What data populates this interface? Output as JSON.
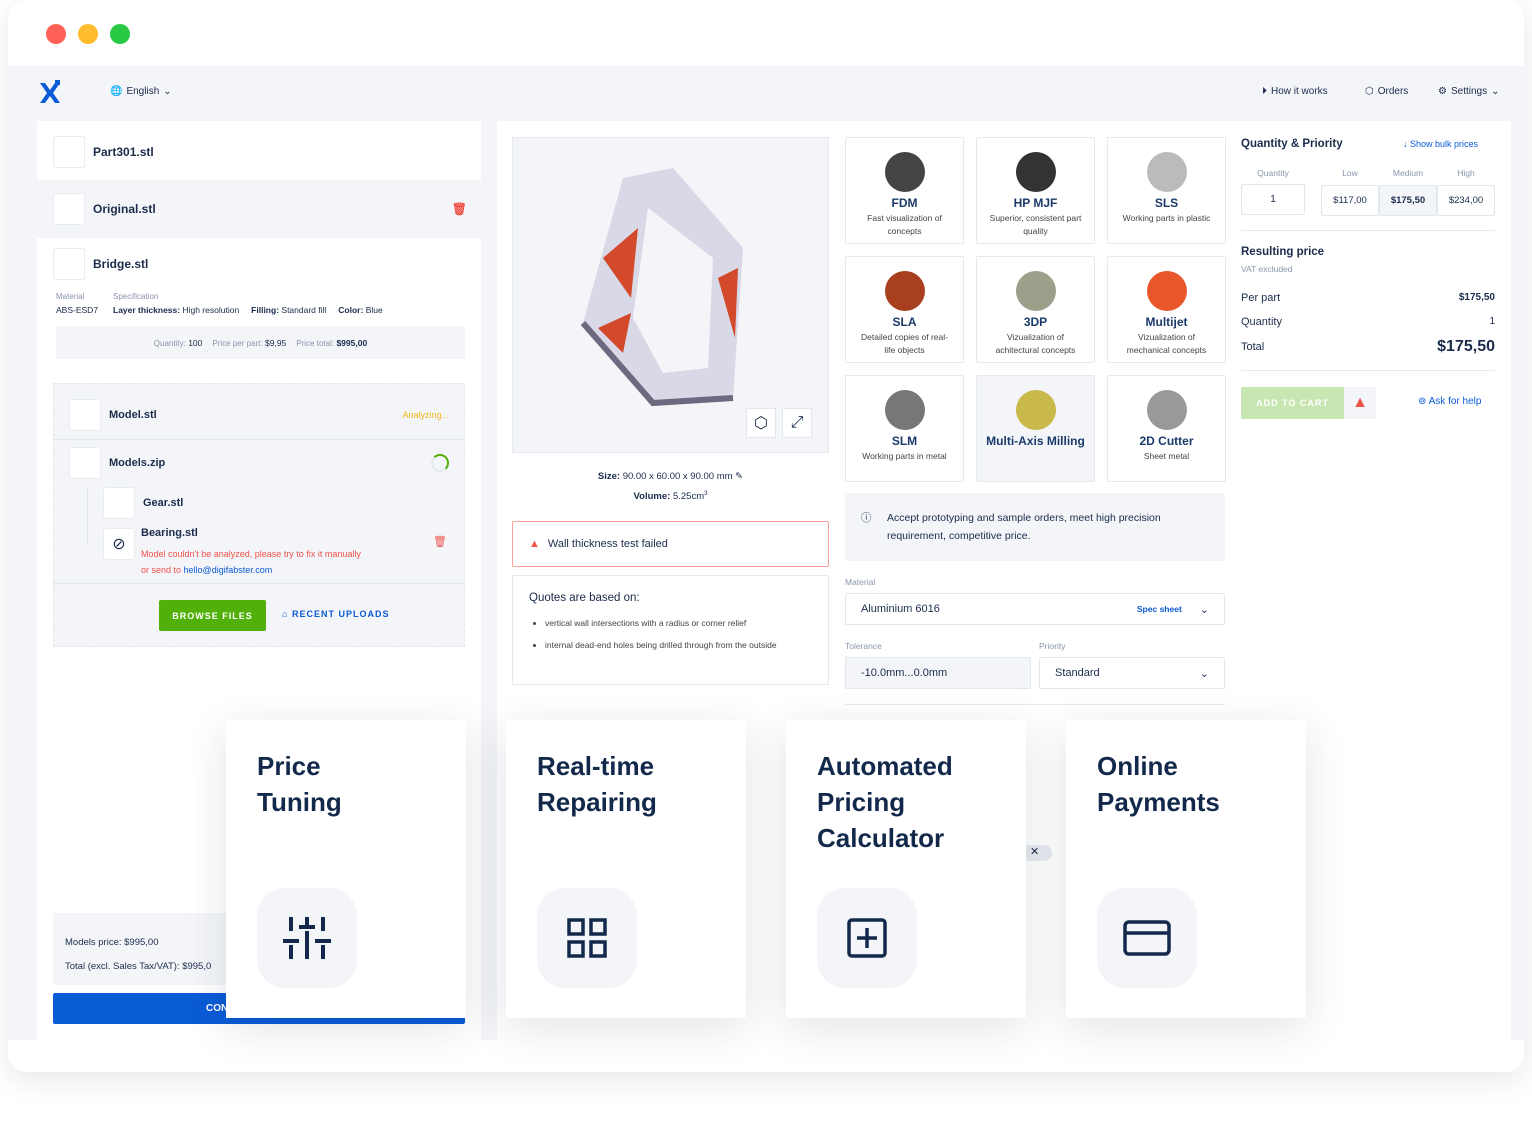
{
  "window": {
    "controls": [
      "close",
      "minimize",
      "maximize"
    ],
    "colors": {
      "close": "#fe5f57",
      "minimize": "#febc2e",
      "maximize": "#28c840"
    }
  },
  "header": {
    "language": "English",
    "nav": [
      {
        "label": "How it works",
        "icon": "play-circle-icon"
      },
      {
        "label": "Orders",
        "icon": "box-icon"
      },
      {
        "label": "Settings",
        "icon": "gear-icon"
      }
    ]
  },
  "files": {
    "items": [
      "Part301.stl",
      "Original.stl",
      "Bridge.stl"
    ],
    "bridge": {
      "material_label": "Material",
      "material": "ABS-ESD7",
      "spec_label": "Specification",
      "layer_label": "Layer thickness:",
      "layer": "High resolution",
      "filling_label": "Filling:",
      "filling": "Standard fill",
      "color_label": "Color:",
      "color": "Blue",
      "qty_label": "Quantity:",
      "qty": "100",
      "ppp_label": "Price per part:",
      "ppp": "$9,95",
      "total_label": "Price total:",
      "total": "$995,00"
    },
    "upload": {
      "model": "Model.stl",
      "model_status": "Analyzing...",
      "zip": "Models.zip",
      "gear": "Gear.stl",
      "bearing": "Bearing.stl",
      "error": "Model couldn't be analyzed, please try to fix it manually",
      "error2": "or send to",
      "email": "hello@digifabster.com",
      "browse": "BROWSE FILES",
      "recent": "RECENT UPLOADS"
    },
    "summary": {
      "models_price": "Models price: $995,00",
      "total": "Total (excl. Sales Tax/VAT): $995,0",
      "button": "CON"
    }
  },
  "viewer": {
    "size_label": "Size:",
    "size": "90.00 x 60.00 x 90.00 mm",
    "volume_label": "Volume:",
    "volume": "5.25cm",
    "volume_sup": "3",
    "warning": "Wall thickness test failed",
    "quotes_title": "Quotes are based on:",
    "quotes": [
      "vertical wall intersections with a radius or corner relief",
      "internal dead-end holes being drilled through from the outside"
    ]
  },
  "technologies": [
    {
      "name": "FDM",
      "desc": "Fast visualization of concepts",
      "color": "#444"
    },
    {
      "name": "HP MJF",
      "desc": "Superior, consistent part quality",
      "color": "#333"
    },
    {
      "name": "SLS",
      "desc": "Working parts in plastic",
      "color": "#bbb"
    },
    {
      "name": "SLA",
      "desc": "Detailed copies of real-life objects",
      "color": "#a8401f"
    },
    {
      "name": "3DP",
      "desc": "Vizualization of achitectural concepts",
      "color": "#9aa08a"
    },
    {
      "name": "Multijet",
      "desc": "Vizualization of mechanical concepts",
      "color": "#e8562a"
    },
    {
      "name": "SLM",
      "desc": "Working parts in metal",
      "color": "#777"
    },
    {
      "name": "Multi-Axis Milling",
      "desc": "",
      "color": "#c9b84a",
      "selected": true
    },
    {
      "name": "2D Cutter",
      "desc": "Sheet metal",
      "color": "#999"
    }
  ],
  "config": {
    "info": "Accept prototyping and sample orders, meet high precision requirement, competitive price.",
    "material_label": "Material",
    "material": "Aluminium 6016",
    "spec_sheet": "Spec sheet",
    "tolerance_label": "Tolerance",
    "tolerance": "-10.0mm...0.0mm",
    "priority_label": "Priority",
    "priority": "Standard"
  },
  "pricing": {
    "title": "Quantity & Priority",
    "bulk": "Show bulk prices",
    "qty_label": "Quantity",
    "qty": "1",
    "tiers": [
      {
        "label": "Low",
        "price": "$117,00"
      },
      {
        "label": "Medium",
        "price": "$175,50",
        "selected": true
      },
      {
        "label": "High",
        "price": "$234,00"
      }
    ],
    "result_title": "Resulting price",
    "vat": "VAT excluded",
    "per_part_label": "Per part",
    "per_part": "$175,50",
    "quantity_label": "Quantity",
    "quantity": "1",
    "total_label": "Total",
    "total": "$175,50",
    "add_to_cart": "ADD TO CART",
    "help": "Ask for help"
  },
  "features": [
    {
      "title": "Price Tuning",
      "icon": "sliders-icon"
    },
    {
      "title": "Real-time Repairing",
      "icon": "grid-icon"
    },
    {
      "title": "Automated Pricing Calculator",
      "icon": "plus-square-icon"
    },
    {
      "title": "Online Payments",
      "icon": "credit-card-icon"
    }
  ],
  "colors": {
    "accent": "#0a5bd6",
    "success": "#52b00a",
    "danger": "#f0524a",
    "warning": "#f3b719",
    "text": "#1b2b4b"
  }
}
